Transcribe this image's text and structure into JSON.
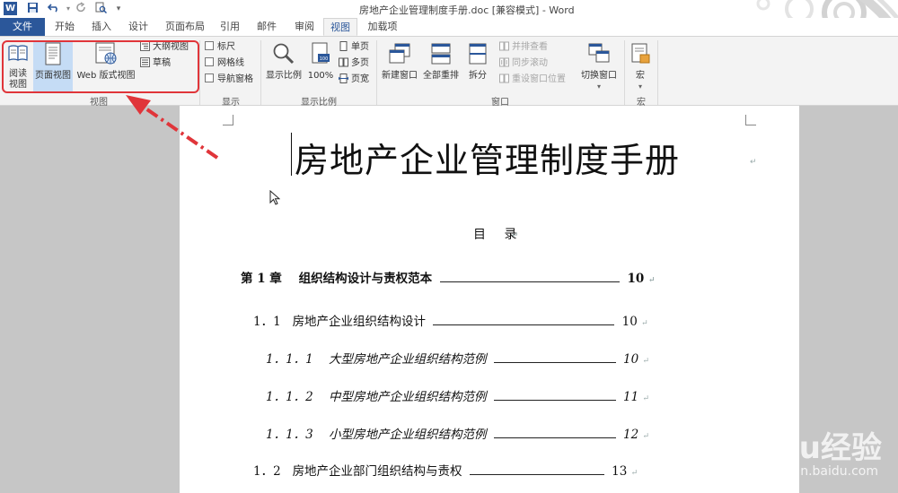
{
  "titlebar": {
    "logo": "W",
    "title": "房地产企业管理制度手册.doc [兼容模式] - Word",
    "quick_access": [
      "save-icon",
      "undo-icon",
      "redo-icon",
      "print-preview-icon",
      "customize-icon"
    ]
  },
  "tabs": [
    "文件",
    "开始",
    "插入",
    "设计",
    "页面布局",
    "引用",
    "邮件",
    "审阅",
    "视图",
    "加载项"
  ],
  "active_tab": "视图",
  "ribbon": {
    "views": {
      "label": "视图",
      "read_mode": "阅读\n视图",
      "read_mode_line1": "阅读",
      "read_mode_line2": "视图",
      "print_layout": "页面视图",
      "web_layout": "Web 版式视图",
      "outline": "大纲视图",
      "draft": "草稿"
    },
    "show": {
      "label": "显示",
      "ruler": "标尺",
      "gridlines": "网格线",
      "nav_pane": "导航窗格"
    },
    "zoom": {
      "label": "显示比例",
      "zoom": "显示比例",
      "hundred": "100%",
      "one_page": "单页",
      "multi_page": "多页",
      "page_width": "页宽"
    },
    "window": {
      "label": "窗口",
      "new_window": "新建窗口",
      "arrange_all": "全部重排",
      "split": "拆分",
      "side_by_side": "并排查看",
      "sync_scroll": "同步滚动",
      "reset_position": "重设窗口位置",
      "switch_windows": "切换窗口"
    },
    "macros": {
      "label": "宏",
      "macros": "宏"
    }
  },
  "document": {
    "title": "房地产企业管理制度手册",
    "toc_heading": "目 录",
    "toc": [
      {
        "num": "第 1 章",
        "text": "组织结构设计与责权范本",
        "page": "10",
        "style": "bold"
      },
      {
        "num": "1．1",
        "text": "房地产企业组织结构设计",
        "page": "10",
        "style": "normal"
      },
      {
        "num": "1．1．1",
        "text": "大型房地产企业组织结构范例",
        "page": "10",
        "style": "italic"
      },
      {
        "num": "1．1．2",
        "text": "中型房地产企业组织结构范例",
        "page": "11",
        "style": "italic"
      },
      {
        "num": "1．1．3",
        "text": "小型房地产企业组织结构范例",
        "page": "12",
        "style": "italic"
      },
      {
        "num": "1．2",
        "text": "房地产企业部门组织结构与责权",
        "page": "13",
        "style": "normal"
      }
    ],
    "para_mark": "↵"
  },
  "watermark": {
    "brand": "Baidu经验",
    "url": "jingyan.baidu.com"
  },
  "colors": {
    "accent": "#2b579a",
    "annotation_red": "#e0353a",
    "selected_view": "#c5dcf5"
  }
}
